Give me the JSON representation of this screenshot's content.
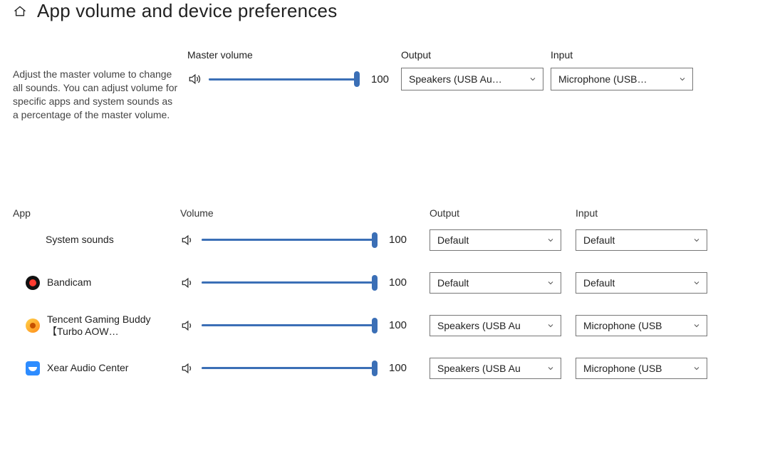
{
  "title": "App volume and device preferences",
  "master": {
    "description": "Adjust the master volume to change all sounds. You can adjust volume for specific apps and system sounds as a percentage of the master volume.",
    "volume_label": "Master volume",
    "output_label": "Output",
    "input_label": "Input",
    "volume": 100,
    "output": "Speakers (USB Au…",
    "input": "Microphone (USB…"
  },
  "apps_header": {
    "app": "App",
    "volume": "Volume",
    "output": "Output",
    "input": "Input"
  },
  "apps": [
    {
      "name": "System sounds",
      "icon": "",
      "volume": 100,
      "output": "Default",
      "input": "Default"
    },
    {
      "name": "Bandicam",
      "icon": "bandicam",
      "volume": 100,
      "output": "Default",
      "input": "Default"
    },
    {
      "name": "Tencent Gaming Buddy【Turbo AOW…",
      "icon": "tencent",
      "volume": 100,
      "output": "Speakers (USB Au",
      "input": "Microphone (USB"
    },
    {
      "name": "Xear Audio Center",
      "icon": "xear",
      "volume": 100,
      "output": "Speakers (USB Au",
      "input": "Microphone (USB"
    }
  ]
}
